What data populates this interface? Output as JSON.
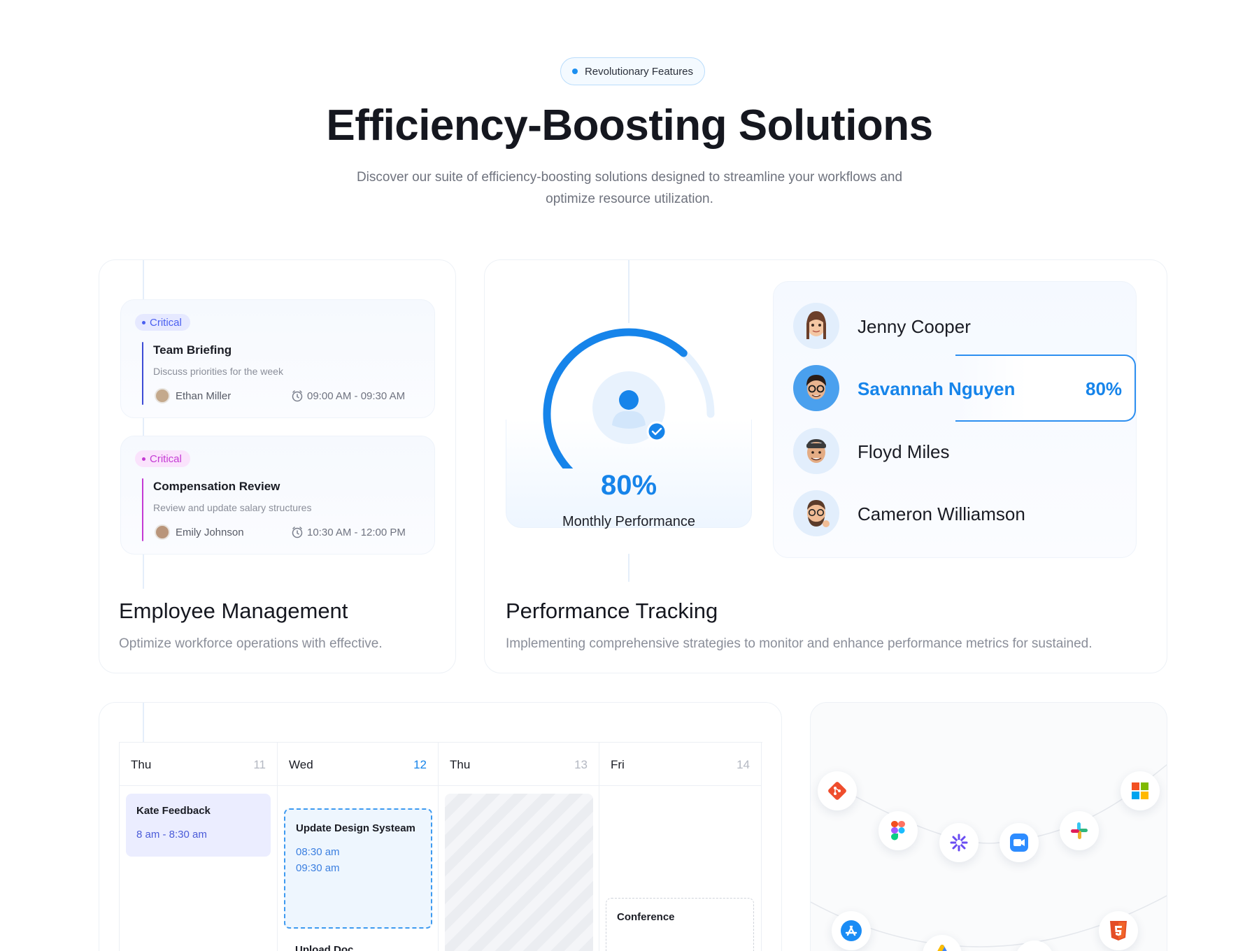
{
  "hero": {
    "badge": "Revolutionary Features",
    "title": "Efficiency-Boosting Solutions",
    "subtitle_line1": "Discover our suite of efficiency-boosting solutions designed to streamline your workflows and",
    "subtitle_line2": "optimize resource utilization."
  },
  "employee_card": {
    "tasks": [
      {
        "tag": "Critical",
        "tag_color": "#4a5ff0",
        "tag_bg": "#e6e9ff",
        "accent": "#3d4cd6",
        "title": "Team Briefing",
        "description": "Discuss priorities for the week",
        "person": "Ethan Miller",
        "time": "09:00 AM - 09:30 AM"
      },
      {
        "tag": "Critical",
        "tag_color": "#c43ad4",
        "tag_bg": "#fae3fc",
        "accent": "#c43ad4",
        "title": "Compensation Review",
        "description": "Review and update salary structures",
        "person": "Emily Johnson",
        "time": "10:30 AM - 12:00 PM"
      }
    ],
    "title": "Employee Management",
    "description": "Optimize workforce operations with effective."
  },
  "performance_card": {
    "gauge_value": 0.8,
    "percent": "80%",
    "label": "Monthly Performance",
    "people": [
      {
        "name": "Jenny Cooper",
        "highlighted": false
      },
      {
        "name": "Savannah Nguyen",
        "highlighted": true,
        "score": "80%"
      },
      {
        "name": "Floyd Miles",
        "highlighted": false
      },
      {
        "name": "Cameron Williamson",
        "highlighted": false
      }
    ],
    "title": "Performance Tracking",
    "description": "Implementing comprehensive strategies to monitor and enhance performance metrics for sustained."
  },
  "calendar_card": {
    "columns": [
      {
        "day": "Thu",
        "date": "11",
        "active": false
      },
      {
        "day": "Wed",
        "date": "12",
        "active": true
      },
      {
        "day": "Thu",
        "date": "13",
        "active": false
      },
      {
        "day": "Fri",
        "date": "14",
        "active": false
      }
    ],
    "events": {
      "kate": {
        "title": "Kate Feedback",
        "time": "8 am - 8:30 am"
      },
      "design": {
        "title": "Update Design Systeam",
        "start": "08:30 am",
        "end": "09:30 am"
      },
      "upload": {
        "title": "Upload Doc"
      },
      "conference": {
        "title": "Conference"
      }
    }
  },
  "integrations_card": {
    "icons": [
      "git-icon",
      "figma-icon",
      "asterisk-icon",
      "zoom-icon",
      "slack-icon",
      "windows-icon",
      "app-store-icon",
      "html5-icon",
      "google-ads-icon",
      "gmail-icon"
    ]
  },
  "colors": {
    "accent": "#1684ea",
    "text_dark": "#15171f",
    "text_muted": "#8a8e99"
  }
}
